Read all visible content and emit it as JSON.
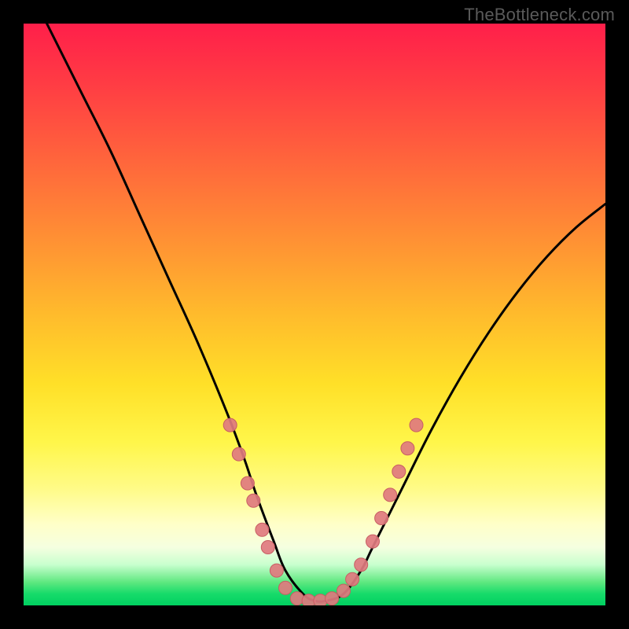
{
  "watermark": "TheBottleneck.com",
  "colors": {
    "curve_stroke": "#000000",
    "marker_fill": "#e07a7f",
    "marker_stroke": "#c85e63",
    "frame": "#000000"
  },
  "chart_data": {
    "type": "line",
    "title": "",
    "xlabel": "",
    "ylabel": "",
    "xlim": [
      0,
      100
    ],
    "ylim": [
      0,
      100
    ],
    "grid": false,
    "series": [
      {
        "name": "bottleneck-curve",
        "x": [
          0,
          5,
          10,
          15,
          20,
          25,
          30,
          35,
          38,
          40,
          43,
          45,
          48,
          50,
          52,
          55,
          58,
          60,
          65,
          70,
          75,
          80,
          85,
          90,
          95,
          100
        ],
        "y": [
          108,
          98,
          88,
          78,
          67,
          56,
          45,
          33,
          25,
          19,
          11,
          6,
          2,
          0.8,
          0.8,
          2,
          6,
          10,
          20,
          30,
          39,
          47,
          54,
          60,
          65,
          69
        ]
      }
    ],
    "markers": {
      "name": "highlight-points",
      "points": [
        {
          "x": 35.5,
          "y": 31
        },
        {
          "x": 37.0,
          "y": 26
        },
        {
          "x": 38.5,
          "y": 21
        },
        {
          "x": 39.5,
          "y": 18
        },
        {
          "x": 41.0,
          "y": 13
        },
        {
          "x": 42.0,
          "y": 10
        },
        {
          "x": 43.5,
          "y": 6
        },
        {
          "x": 45.0,
          "y": 3
        },
        {
          "x": 47.0,
          "y": 1.2
        },
        {
          "x": 49.0,
          "y": 0.8
        },
        {
          "x": 51.0,
          "y": 0.8
        },
        {
          "x": 53.0,
          "y": 1.2
        },
        {
          "x": 55.0,
          "y": 2.5
        },
        {
          "x": 56.5,
          "y": 4.5
        },
        {
          "x": 58.0,
          "y": 7
        },
        {
          "x": 60.0,
          "y": 11
        },
        {
          "x": 61.5,
          "y": 15
        },
        {
          "x": 63.0,
          "y": 19
        },
        {
          "x": 64.5,
          "y": 23
        },
        {
          "x": 66.0,
          "y": 27
        },
        {
          "x": 67.5,
          "y": 31
        }
      ]
    }
  }
}
